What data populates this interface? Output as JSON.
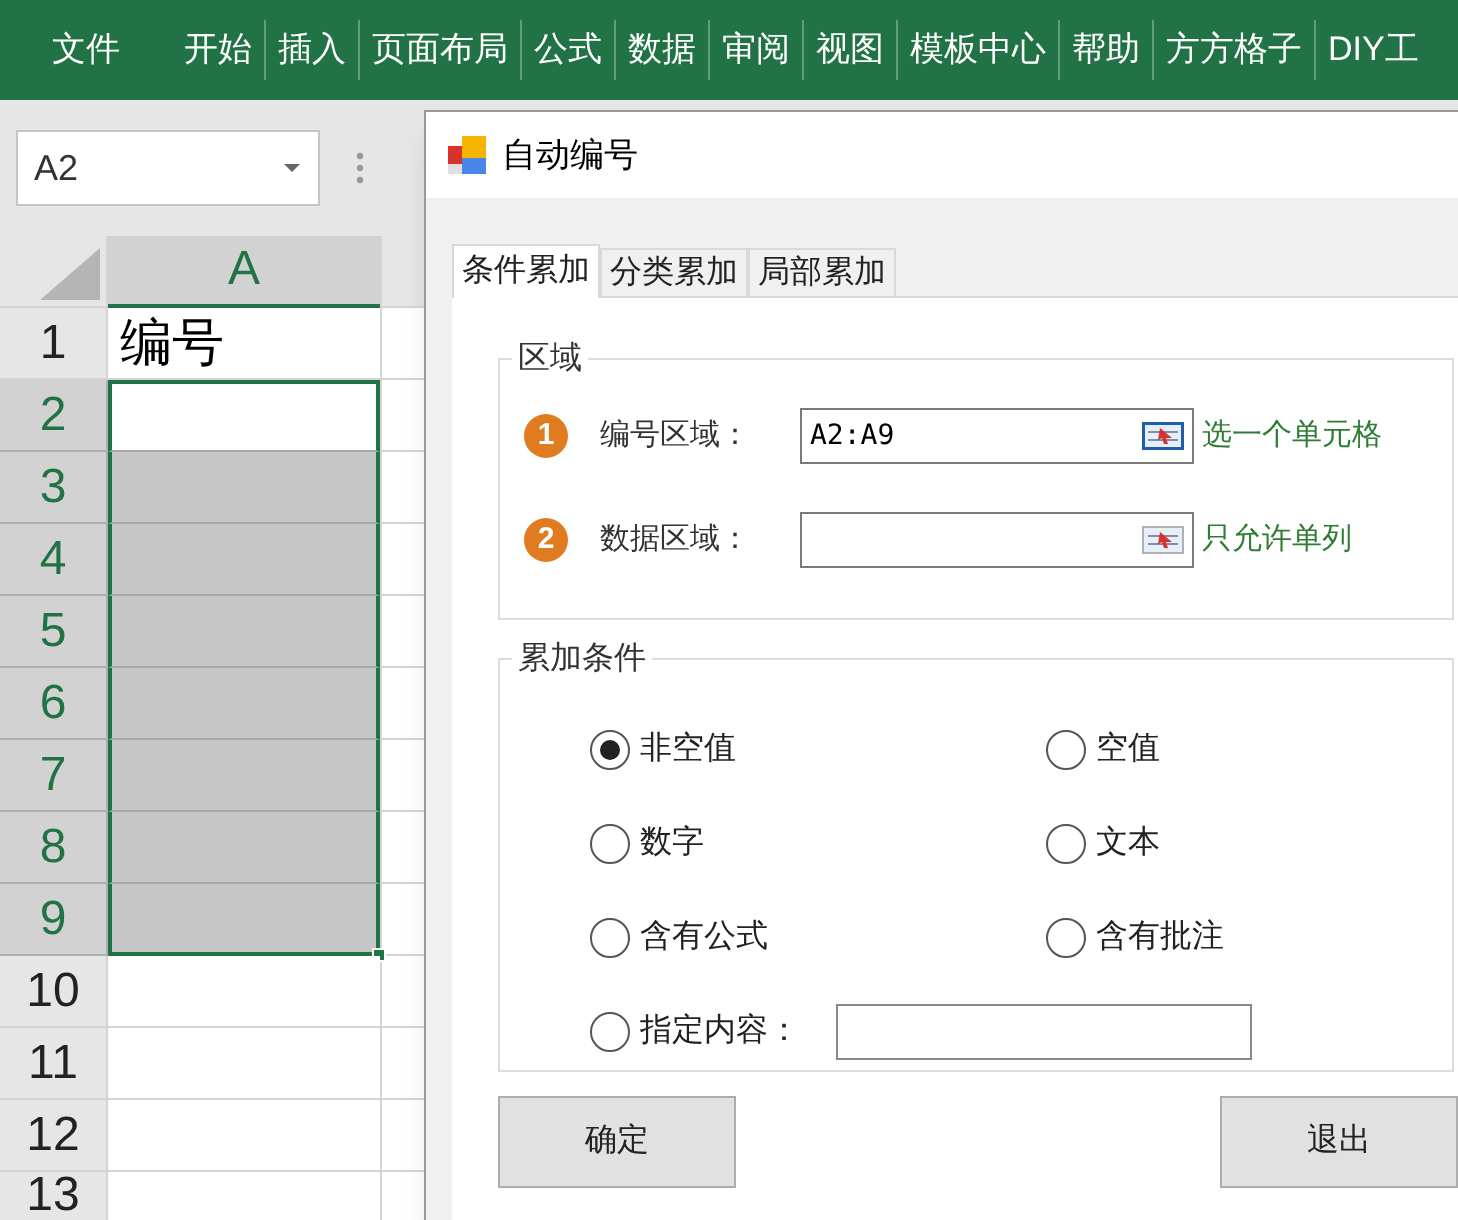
{
  "ribbon": {
    "tabs": [
      {
        "label": "文件",
        "kind": "file"
      },
      {
        "label": "开始",
        "kind": "tab"
      },
      {
        "label": "插入",
        "kind": "tab"
      },
      {
        "label": "页面布局",
        "kind": "tab"
      },
      {
        "label": "公式",
        "kind": "tab"
      },
      {
        "label": "数据",
        "kind": "tab"
      },
      {
        "label": "审阅",
        "kind": "tab"
      },
      {
        "label": "视图",
        "kind": "tab"
      },
      {
        "label": "模板中心",
        "kind": "tab"
      },
      {
        "label": "帮助",
        "kind": "tab"
      },
      {
        "label": "方方格子",
        "kind": "tab"
      },
      {
        "label": "DIY工",
        "kind": "tab"
      }
    ]
  },
  "name_box": {
    "value": "A2"
  },
  "sheet": {
    "columns": [
      {
        "label": "A",
        "selected": true
      }
    ],
    "rows": [
      {
        "header": "1",
        "selected": false,
        "cell": "编号"
      },
      {
        "header": "2",
        "selected": true,
        "active": true
      },
      {
        "header": "3",
        "selected": true,
        "active": false
      },
      {
        "header": "4",
        "selected": true,
        "active": false
      },
      {
        "header": "5",
        "selected": true,
        "active": false
      },
      {
        "header": "6",
        "selected": true,
        "active": false
      },
      {
        "header": "7",
        "selected": true,
        "active": false
      },
      {
        "header": "8",
        "selected": true,
        "active": false
      },
      {
        "header": "9",
        "selected": true,
        "active": false
      },
      {
        "header": "10",
        "selected": false
      },
      {
        "header": "11",
        "selected": false
      },
      {
        "header": "12",
        "selected": false
      },
      {
        "header": "13",
        "selected": false
      }
    ]
  },
  "dialog": {
    "title": "自动编号",
    "tabs": [
      {
        "label": "条件累加",
        "selected": true
      },
      {
        "label": "分类累加",
        "selected": false
      },
      {
        "label": "局部累加",
        "selected": false
      }
    ],
    "area_group": {
      "title": "区域",
      "fields": [
        {
          "step": "1",
          "label": "编号区域：",
          "value": "A2:A9",
          "hint": "选一个单元格",
          "active": true
        },
        {
          "step": "2",
          "label": "数据区域：",
          "hint": "只允许单列",
          "active": false
        }
      ]
    },
    "condition_group": {
      "title": "累加条件",
      "options": [
        {
          "label": "非空值",
          "selected": true,
          "kind": "radio"
        },
        {
          "label": "空值",
          "selected": false,
          "kind": "radio"
        },
        {
          "label": "数字",
          "selected": false,
          "kind": "radio"
        },
        {
          "label": "文本",
          "selected": false,
          "kind": "radio"
        },
        {
          "label": "含有公式",
          "selected": false,
          "kind": "radio"
        },
        {
          "label": "含有批注",
          "selected": false,
          "kind": "radio"
        },
        {
          "label": "指定内容：",
          "selected": false,
          "kind": "radio_with_field"
        }
      ]
    },
    "buttons": [
      {
        "label": "确定"
      },
      {
        "label": "退出"
      }
    ]
  }
}
